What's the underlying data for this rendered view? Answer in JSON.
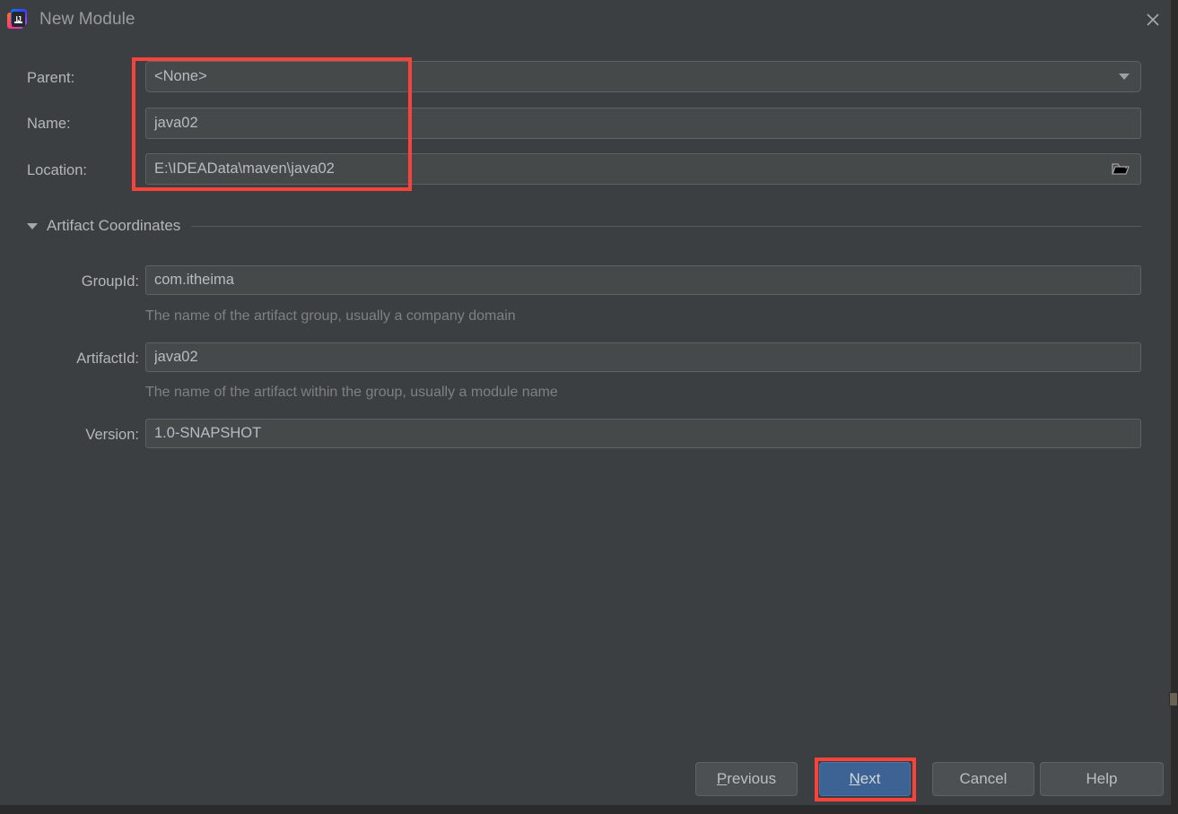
{
  "window": {
    "title": "New Module",
    "logo_icon": "intellij-idea-logo-icon",
    "logo_text": "IJ",
    "close_icon": "close-icon"
  },
  "form": {
    "parent": {
      "label": "Parent:",
      "value": "<None>",
      "dropdown_icon": "chevron-down-icon"
    },
    "name": {
      "label": "Name:",
      "value": "java02"
    },
    "location": {
      "label": "Location:",
      "value": "E:\\IDEAData\\maven\\java02",
      "browse_icon": "folder-icon"
    }
  },
  "artifact_section": {
    "title": "Artifact Coordinates",
    "expander_icon": "triangle-down-icon",
    "group_id": {
      "label": "GroupId:",
      "value": "com.itheima",
      "hint": "The name of the artifact group, usually a company domain"
    },
    "artifact_id": {
      "label": "ArtifactId:",
      "value": "java02",
      "hint": "The name of the artifact within the group, usually a module name"
    },
    "version": {
      "label": "Version:",
      "value": "1.0-SNAPSHOT"
    }
  },
  "buttons": {
    "previous": {
      "mnemonic": "P",
      "rest": "revious"
    },
    "next": {
      "mnemonic": "N",
      "rest": "ext"
    },
    "cancel": {
      "label": "Cancel"
    },
    "help": {
      "label": "Help"
    }
  },
  "annotations": {
    "highlight_color": "#f9423a",
    "boxes": [
      {
        "name": "fields-highlight"
      },
      {
        "name": "next-button-highlight"
      }
    ]
  },
  "colors": {
    "background": "#3c3f41",
    "field_background": "#45494a",
    "primary_button": "#3c6394",
    "text": "#b4b7b9",
    "hint_text": "#7d8183"
  }
}
